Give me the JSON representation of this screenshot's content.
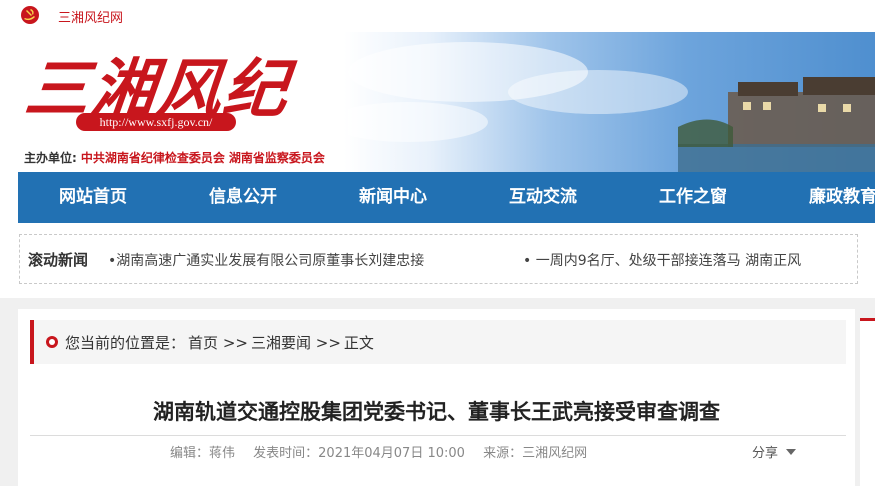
{
  "topbar": {
    "site_name": "三湘风纪网",
    "emblem_icon": "party-emblem-icon"
  },
  "header": {
    "logo_text": "三湘风纪",
    "url": "http://www.sxfj.gov.cn/",
    "sponsor_label": "主办单位:",
    "sponsor_org_1": "中共湖南省纪律检查委员会",
    "sponsor_org_2": "湖南省监察委员会"
  },
  "nav": {
    "items": [
      {
        "label": "网站首页"
      },
      {
        "label": "信息公开"
      },
      {
        "label": "新闻中心"
      },
      {
        "label": "互动交流"
      },
      {
        "label": "工作之窗"
      },
      {
        "label": "廉政教育"
      }
    ]
  },
  "ticker": {
    "label": "滚动新闻",
    "items": [
      "•湖南高速广通实业发展有限公司原董事长刘建忠接",
      "• 一周内9名厅、处级干部接连落马 湖南正风"
    ]
  },
  "breadcrumb": {
    "prefix": "您当前的位置是：",
    "home": "首页",
    "sep1": ">>",
    "section": "三湘要闻",
    "sep2": ">>",
    "current": "正文"
  },
  "article": {
    "title": "湖南轨道交通控股集团党委书记、董事长王武亮接受审查调查",
    "editor": "编辑：蒋伟",
    "published": "发表时间：2021年04月07日 10:00",
    "source": "来源：三湘风纪网",
    "share_label": "分享"
  },
  "colors": {
    "brand_red": "#c8161d",
    "nav_blue": "#2271b3"
  }
}
